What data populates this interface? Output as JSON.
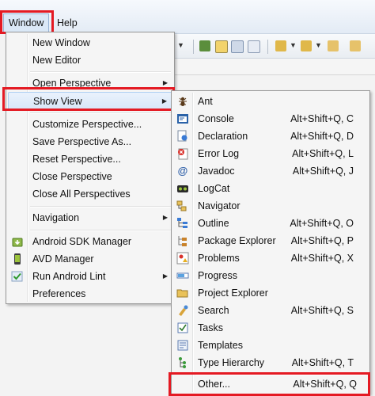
{
  "menubar": {
    "window_label": "Window",
    "help_label": "Help"
  },
  "window_menu": {
    "items": [
      {
        "label": "New Window",
        "submenu": false
      },
      {
        "label": "New Editor",
        "submenu": false
      },
      {
        "label": "Open Perspective",
        "submenu": true
      },
      {
        "label": "Show View",
        "submenu": true
      },
      {
        "label": "Customize Perspective...",
        "submenu": false
      },
      {
        "label": "Save Perspective As...",
        "submenu": false
      },
      {
        "label": "Reset Perspective...",
        "submenu": false
      },
      {
        "label": "Close Perspective",
        "submenu": false
      },
      {
        "label": "Close All Perspectives",
        "submenu": false
      },
      {
        "label": "Navigation",
        "submenu": true
      },
      {
        "label": "Android SDK Manager",
        "icon": "android-sdk-manager-icon"
      },
      {
        "label": "AVD Manager",
        "icon": "avd-manager-icon"
      },
      {
        "label": "Run Android Lint",
        "icon": "lint-check-icon",
        "submenu": true
      },
      {
        "label": "Preferences",
        "submenu": false
      }
    ]
  },
  "show_view_menu": {
    "items": [
      {
        "label": "Ant",
        "accel": "",
        "icon": "ant-icon"
      },
      {
        "label": "Console",
        "accel": "Alt+Shift+Q, C",
        "icon": "console-icon"
      },
      {
        "label": "Declaration",
        "accel": "Alt+Shift+Q, D",
        "icon": "declaration-icon"
      },
      {
        "label": "Error Log",
        "accel": "Alt+Shift+Q, L",
        "icon": "error-log-icon"
      },
      {
        "label": "Javadoc",
        "accel": "Alt+Shift+Q, J",
        "icon": "javadoc-icon"
      },
      {
        "label": "LogCat",
        "accel": "",
        "icon": "logcat-icon"
      },
      {
        "label": "Navigator",
        "accel": "",
        "icon": "navigator-icon"
      },
      {
        "label": "Outline",
        "accel": "Alt+Shift+Q, O",
        "icon": "outline-icon"
      },
      {
        "label": "Package Explorer",
        "accel": "Alt+Shift+Q, P",
        "icon": "package-explorer-icon"
      },
      {
        "label": "Problems",
        "accel": "Alt+Shift+Q, X",
        "icon": "problems-icon"
      },
      {
        "label": "Progress",
        "accel": "",
        "icon": "progress-icon"
      },
      {
        "label": "Project Explorer",
        "accel": "",
        "icon": "project-explorer-icon"
      },
      {
        "label": "Search",
        "accel": "Alt+Shift+Q, S",
        "icon": "search-icon"
      },
      {
        "label": "Tasks",
        "accel": "",
        "icon": "tasks-icon"
      },
      {
        "label": "Templates",
        "accel": "",
        "icon": "templates-icon"
      },
      {
        "label": "Type Hierarchy",
        "accel": "Alt+Shift+Q, T",
        "icon": "type-hierarchy-icon"
      },
      {
        "label": "Other...",
        "accel": "Alt+Shift+Q, Q",
        "icon": ""
      }
    ]
  },
  "colors": {
    "highlight_box": "#e41a23",
    "menu_bg": "#f5f5f5"
  }
}
